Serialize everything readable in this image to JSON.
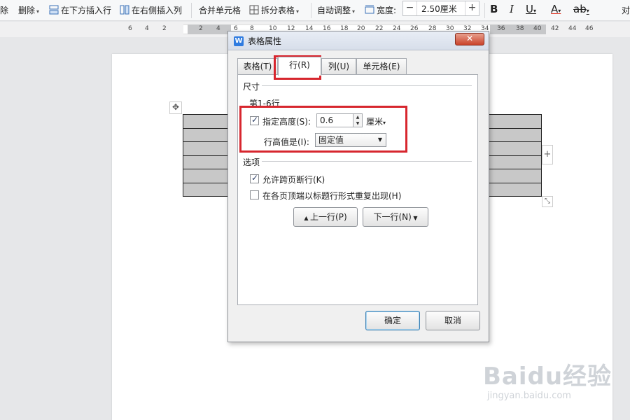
{
  "toolbar": {
    "delete_partial": "除",
    "delete_label": "删除",
    "insert_below": "在下方插入行",
    "insert_right": "在右侧插入列",
    "merge_cells": "合并单元格",
    "split_table": "拆分表格",
    "auto_fit": "自动调整",
    "width_label": "宽度:",
    "width_value": "2.50厘米",
    "minus": "−",
    "plus": "+",
    "bold": "B",
    "italic": "I",
    "underline": "U",
    "font_color": "A",
    "clear_format": "ab",
    "right_edge_char": "对"
  },
  "ruler": {
    "numbers": [
      "6",
      "4",
      "2",
      "2",
      "4",
      "6",
      "8",
      "10",
      "12",
      "14",
      "16",
      "18",
      "20",
      "22",
      "24",
      "26",
      "28",
      "30",
      "32",
      "34",
      "36",
      "38",
      "40",
      "42",
      "44",
      "46"
    ]
  },
  "canvas": {
    "add_col_symbol": "+",
    "move_symbol": "✥",
    "resize_symbol": "⤡"
  },
  "dialog": {
    "title": "表格属性",
    "app_icon_letter": "W",
    "close_symbol": "✕",
    "tabs": [
      "表格(T)",
      "行(R)",
      "列(U)",
      "单元格(E)"
    ],
    "active_tab_index": 1,
    "size_section": "尺寸",
    "rows_range": "第1-6行",
    "specify_height_label": "指定高度(S):",
    "specify_height_checked": true,
    "height_value": "0.6",
    "height_unit": "厘米",
    "row_height_is_label": "行高值是(I):",
    "row_height_is_value": "固定值",
    "options_section": "选项",
    "allow_break_label": "允许跨页断行(K)",
    "allow_break_checked": true,
    "repeat_header_label": "在各页顶端以标题行形式重复出现(H)",
    "repeat_header_checked": false,
    "prev_row_button": "上一行(P)",
    "next_row_button": "下一行(N)",
    "ok_button": "确定",
    "cancel_button": "取消"
  },
  "watermark": {
    "brand": "Baidu经验",
    "url": "jingyan.baidu.com"
  },
  "colors": {
    "highlight": "#d7262e",
    "table_fill": "#c8c8c8",
    "dialog_bg": "#f0f0f0"
  }
}
